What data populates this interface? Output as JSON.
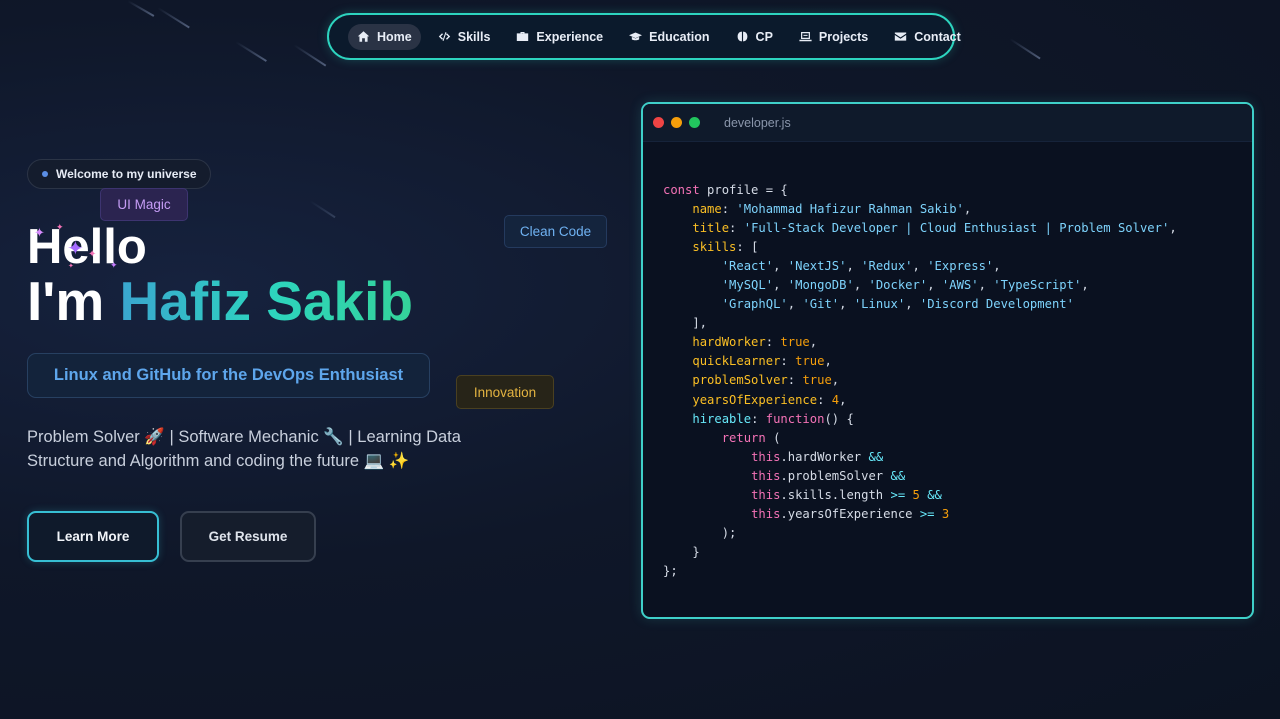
{
  "nav": {
    "items": [
      {
        "label": "Home",
        "icon": "home-icon",
        "active": true
      },
      {
        "label": "Skills",
        "icon": "code-icon",
        "active": false
      },
      {
        "label": "Experience",
        "icon": "briefcase-icon",
        "active": false
      },
      {
        "label": "Education",
        "icon": "graduation-cap-icon",
        "active": false
      },
      {
        "label": "CP",
        "icon": "brain-icon",
        "active": false
      },
      {
        "label": "Projects",
        "icon": "laptop-icon",
        "active": false
      },
      {
        "label": "Contact",
        "icon": "envelope-icon",
        "active": false
      }
    ]
  },
  "hero": {
    "welcome": "Welcome to my universe",
    "tag_magic": "UI Magic",
    "tag_clean": "Clean Code",
    "tag_innovation": "Innovation",
    "greeting": "Hello",
    "intro_prefix": "I'm",
    "name": "Hafiz Sakib",
    "subtitle": "Linux and GitHub for the DevOps Enthusiast",
    "description": "Problem Solver 🚀 | Software Mechanic 🔧 | Learning Data Structure and Algorithm and coding the future 💻 ✨",
    "learn_more": "Learn More",
    "get_resume": "Get Resume"
  },
  "code_window": {
    "filename": "developer.js",
    "window_dot_colors": [
      "#ef4444",
      "#f59e0b",
      "#22c55e"
    ],
    "lines": [
      [
        [
          "k",
          "const"
        ],
        [
          "t",
          " profile = {"
        ]
      ],
      [
        [
          "t",
          "    "
        ],
        [
          "p",
          "name"
        ],
        [
          "t",
          ": "
        ],
        [
          "s",
          "'Mohammad Hafizur Rahman Sakib'"
        ],
        [
          "t",
          ","
        ]
      ],
      [
        [
          "t",
          "    "
        ],
        [
          "p",
          "title"
        ],
        [
          "t",
          ": "
        ],
        [
          "s",
          "'Full-Stack Developer | Cloud Enthusiast | Problem Solver'"
        ],
        [
          "t",
          ","
        ]
      ],
      [
        [
          "t",
          "    "
        ],
        [
          "p",
          "skills"
        ],
        [
          "t",
          ": ["
        ]
      ],
      [
        [
          "t",
          "        "
        ],
        [
          "s",
          "'React'"
        ],
        [
          "t",
          ", "
        ],
        [
          "s",
          "'NextJS'"
        ],
        [
          "t",
          ", "
        ],
        [
          "s",
          "'Redux'"
        ],
        [
          "t",
          ", "
        ],
        [
          "s",
          "'Express'"
        ],
        [
          "t",
          ","
        ]
      ],
      [
        [
          "t",
          "        "
        ],
        [
          "s",
          "'MySQL'"
        ],
        [
          "t",
          ", "
        ],
        [
          "s",
          "'MongoDB'"
        ],
        [
          "t",
          ", "
        ],
        [
          "s",
          "'Docker'"
        ],
        [
          "t",
          ", "
        ],
        [
          "s",
          "'AWS'"
        ],
        [
          "t",
          ", "
        ],
        [
          "s",
          "'TypeScript'"
        ],
        [
          "t",
          ","
        ]
      ],
      [
        [
          "t",
          "        "
        ],
        [
          "s",
          "'GraphQL'"
        ],
        [
          "t",
          ", "
        ],
        [
          "s",
          "'Git'"
        ],
        [
          "t",
          ", "
        ],
        [
          "s",
          "'Linux'"
        ],
        [
          "t",
          ", "
        ],
        [
          "s",
          "'Discord Development'"
        ]
      ],
      [
        [
          "t",
          "    ],"
        ]
      ],
      [
        [
          "t",
          "    "
        ],
        [
          "p",
          "hardWorker"
        ],
        [
          "t",
          ": "
        ],
        [
          "n",
          "true"
        ],
        [
          "t",
          ","
        ]
      ],
      [
        [
          "t",
          "    "
        ],
        [
          "p",
          "quickLearner"
        ],
        [
          "t",
          ": "
        ],
        [
          "n",
          "true"
        ],
        [
          "t",
          ","
        ]
      ],
      [
        [
          "t",
          "    "
        ],
        [
          "p",
          "problemSolver"
        ],
        [
          "t",
          ": "
        ],
        [
          "n",
          "true"
        ],
        [
          "t",
          ","
        ]
      ],
      [
        [
          "t",
          "    "
        ],
        [
          "p",
          "yearsOfExperience"
        ],
        [
          "t",
          ": "
        ],
        [
          "n",
          "4"
        ],
        [
          "t",
          ","
        ]
      ],
      [
        [
          "t",
          "    "
        ],
        [
          "o",
          "hireable"
        ],
        [
          "t",
          ": "
        ],
        [
          "k",
          "function"
        ],
        [
          "t",
          "() {"
        ]
      ],
      [
        [
          "t",
          "        "
        ],
        [
          "k",
          "return"
        ],
        [
          "t",
          " ("
        ]
      ],
      [
        [
          "t",
          "            "
        ],
        [
          "k",
          "this"
        ],
        [
          "t",
          ".hardWorker "
        ],
        [
          "o",
          "&&"
        ]
      ],
      [
        [
          "t",
          "            "
        ],
        [
          "k",
          "this"
        ],
        [
          "t",
          ".problemSolver "
        ],
        [
          "o",
          "&&"
        ]
      ],
      [
        [
          "t",
          "            "
        ],
        [
          "k",
          "this"
        ],
        [
          "t",
          ".skills.length "
        ],
        [
          "o",
          ">="
        ],
        [
          "t",
          " "
        ],
        [
          "n",
          "5"
        ],
        [
          "t",
          " "
        ],
        [
          "o",
          "&&"
        ]
      ],
      [
        [
          "t",
          "            "
        ],
        [
          "k",
          "this"
        ],
        [
          "t",
          ".yearsOfExperience "
        ],
        [
          "o",
          ">="
        ],
        [
          "t",
          " "
        ],
        [
          "n",
          "3"
        ]
      ],
      [
        [
          "t",
          "        );"
        ]
      ],
      [
        [
          "t",
          "    }"
        ]
      ],
      [
        [
          "t",
          "};"
        ]
      ]
    ]
  }
}
